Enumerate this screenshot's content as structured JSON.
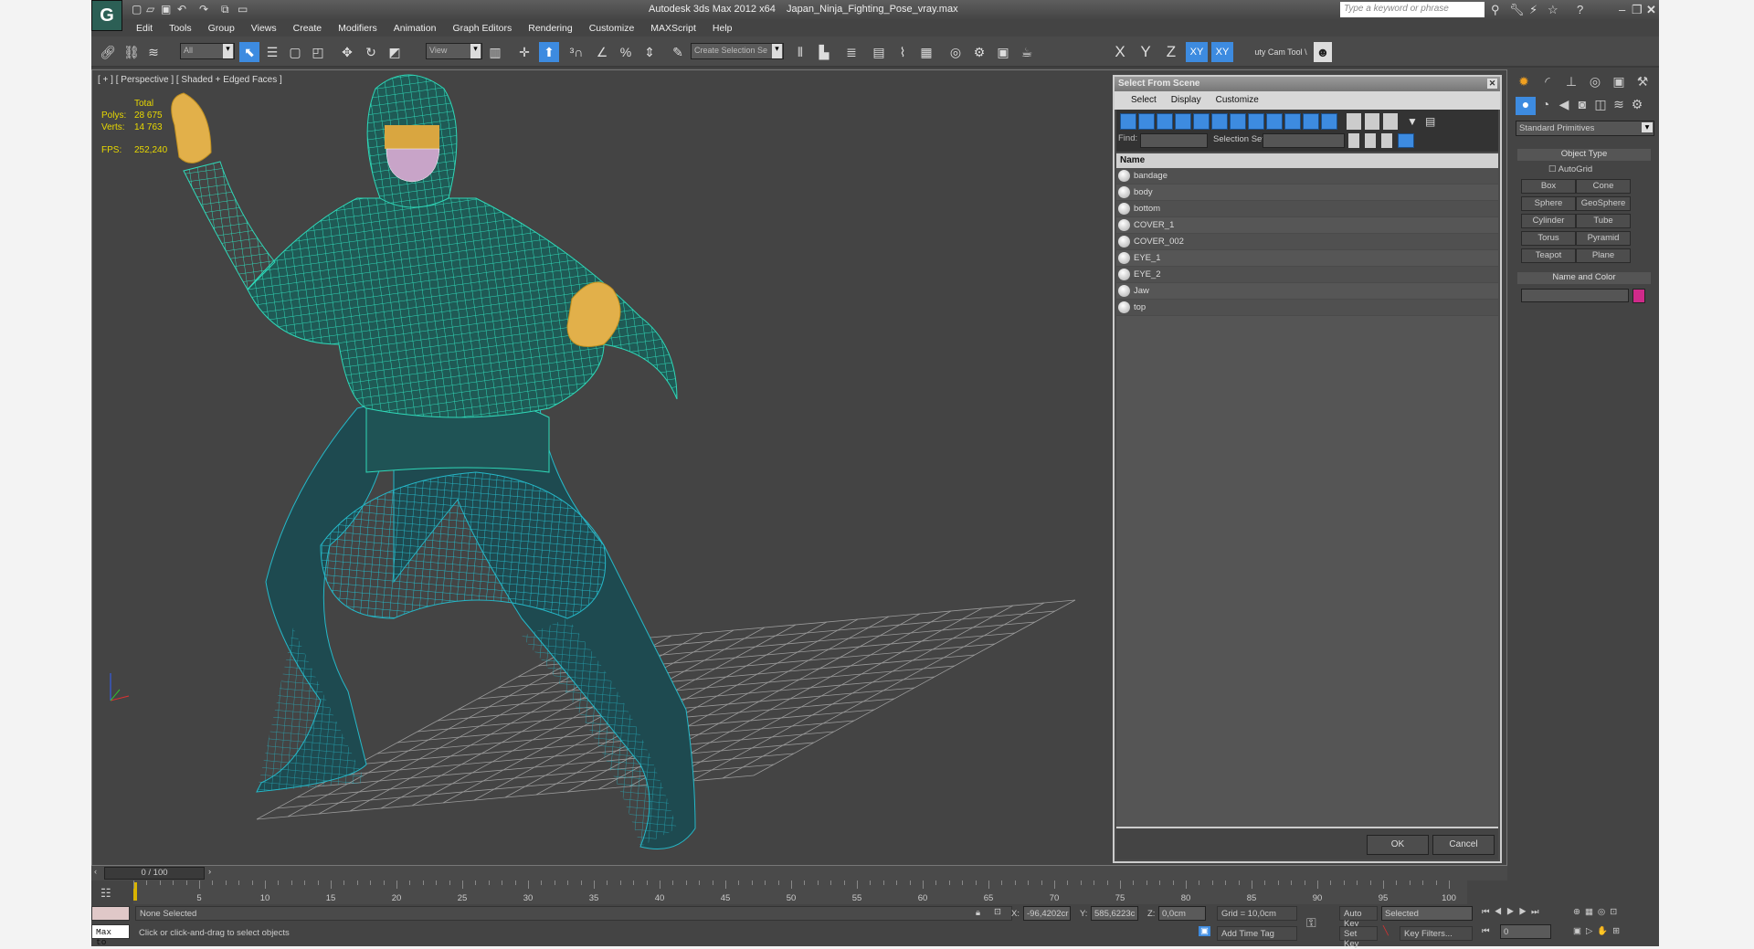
{
  "app": {
    "title": "Autodesk 3ds Max  2012 x64",
    "file": "Japan_Ninja_Fighting_Pose_vray.max",
    "logo": "3ds-max-logo",
    "search_placeholder": "Type a keyword or phrase"
  },
  "menu": [
    "Edit",
    "Tools",
    "Group",
    "Views",
    "Create",
    "Modifiers",
    "Animation",
    "Graph Editors",
    "Rendering",
    "Customize",
    "MAXScript",
    "Help"
  ],
  "toolbar": {
    "filter": "All",
    "ref_coord": "View",
    "selection_set": "Create Selection Se",
    "axis": [
      "X",
      "Y",
      "Z",
      "XY"
    ],
    "xy_snap": "XY",
    "cam_tool": "uty Cam Tool \\"
  },
  "viewport": {
    "label": "[ + ] [ Perspective ] [ Shaded + Edged Faces ]",
    "stats": {
      "header": "Total",
      "polys_label": "Polys:",
      "polys": "28 675",
      "verts_label": "Verts:",
      "verts": "14 763",
      "fps_label": "FPS:",
      "fps": "252,240"
    },
    "mesh_color": "#2fd8b8"
  },
  "dialog": {
    "title": "Select From Scene",
    "menu": [
      "Select",
      "Display",
      "Customize"
    ],
    "find_label": "Find:",
    "find_value": "",
    "selection_set_label": "Selection Set:",
    "column": "Name",
    "items": [
      "bandage",
      "body",
      "bottom",
      "COVER_1",
      "COVER_002",
      "EYE_1",
      "EYE_2",
      "Jaw",
      "top"
    ],
    "ok": "OK",
    "cancel": "Cancel"
  },
  "command_panel": {
    "category": "Standard Primitives",
    "object_type": "Object Type",
    "autogrid": "AutoGrid",
    "buttons": [
      "Box",
      "Cone",
      "Sphere",
      "GeoSphere",
      "Cylinder",
      "Tube",
      "Torus",
      "Pyramid",
      "Teapot",
      "Plane"
    ],
    "name_color": "Name and Color",
    "name_value": "",
    "swatch": "#d02a8a"
  },
  "timeline": {
    "slider": "0 / 100",
    "current": 0,
    "ticks": [
      "5",
      "10",
      "15",
      "20",
      "25",
      "30",
      "35",
      "40",
      "45",
      "50",
      "55",
      "60",
      "65",
      "70",
      "75",
      "80",
      "85",
      "90",
      "95",
      "100"
    ]
  },
  "status": {
    "selection": "None Selected",
    "prompt": "Click or click-and-drag to select objects",
    "maxscript": "Max to",
    "x_label": "X:",
    "x": "-96,4202cr",
    "y_label": "Y:",
    "y": "585,6223c",
    "z_label": "Z:",
    "z": "0,0cm",
    "grid": "Grid = 10,0cm",
    "add_time_tag": "Add Time Tag",
    "auto_key": "Auto Key",
    "key_mode": "Selected",
    "set_key": "Set Key",
    "key_filters": "Key Filters...",
    "frame": "0"
  }
}
